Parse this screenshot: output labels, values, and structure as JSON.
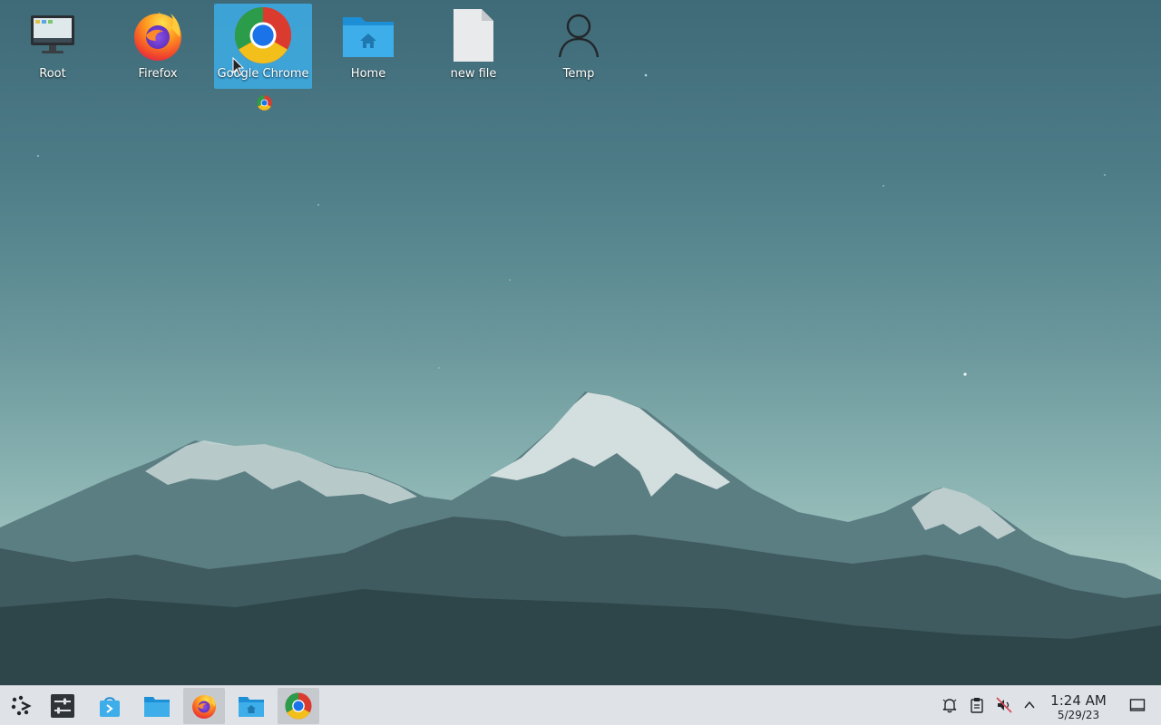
{
  "desktop": {
    "icons": [
      {
        "label": "Root",
        "icon": "computer-icon"
      },
      {
        "label": "Firefox",
        "icon": "firefox-icon"
      },
      {
        "label": "Google Chrome",
        "icon": "chrome-icon",
        "selected": true
      },
      {
        "label": "Home",
        "icon": "home-folder-icon"
      },
      {
        "label": "new file",
        "icon": "file-icon"
      },
      {
        "label": "Temp",
        "icon": "user-icon"
      }
    ]
  },
  "taskbar": {
    "launchers": [
      {
        "name": "application-launcher",
        "icon": "kde-launcher-icon"
      },
      {
        "name": "system-settings",
        "icon": "settings-sliders-icon"
      },
      {
        "name": "discover-store",
        "icon": "store-bag-icon"
      },
      {
        "name": "dolphin-file-manager",
        "icon": "folder-icon"
      },
      {
        "name": "firefox",
        "icon": "firefox-icon",
        "active": true
      },
      {
        "name": "home-folder",
        "icon": "folder-home-icon"
      },
      {
        "name": "google-chrome",
        "icon": "chrome-icon",
        "active": true
      }
    ],
    "tray": [
      "notifications-bell-icon",
      "clipboard-icon",
      "volume-muted-icon",
      "chevron-up-icon"
    ],
    "clock": {
      "time": "1:24 AM",
      "date": "5/29/23"
    },
    "show_desktop_icon": "show-desktop-icon"
  },
  "colors": {
    "selection": "#3daee9",
    "taskbar": "#dfe2e6",
    "sky": "#4d7c87"
  }
}
